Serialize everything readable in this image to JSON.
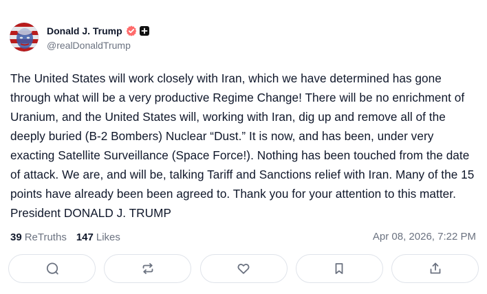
{
  "author": {
    "display_name": "Donald J. Trump",
    "handle": "@realDonaldTrump",
    "verified_color": "#ff6b6b",
    "badge_color": "#111111"
  },
  "post": {
    "text": "The United States will work closely with Iran, which we have determined has gone through what will be a very productive Regime Change! There will be no enrichment of Uranium, and the United States will, working with Iran, dig up and remove all of the deeply buried (B-2 Bombers) Nuclear “Dust.” It is now, and has been, under very exacting Satellite Surveillance (Space Force!). Nothing has been touched from the date of attack. We are, and will be, talking Tariff and Sanctions relief with Iran. Many of the 15 points have already been been agreed to. Thank you for your attention to this matter. President DONALD J. TRUMP"
  },
  "stats": {
    "retruths_count": "39",
    "retruths_label": "ReTruths",
    "likes_count": "147",
    "likes_label": "Likes",
    "timestamp": "Apr 08, 2026, 7:22 PM"
  },
  "actions": [
    {
      "icon": "reply-icon"
    },
    {
      "icon": "retruth-icon"
    },
    {
      "icon": "like-icon"
    },
    {
      "icon": "bookmark-icon"
    },
    {
      "icon": "share-icon"
    }
  ],
  "colors": {
    "text": "#0f172a",
    "muted": "#6b7280",
    "button_border": "#dfe3ea",
    "icon": "#6b7280"
  }
}
